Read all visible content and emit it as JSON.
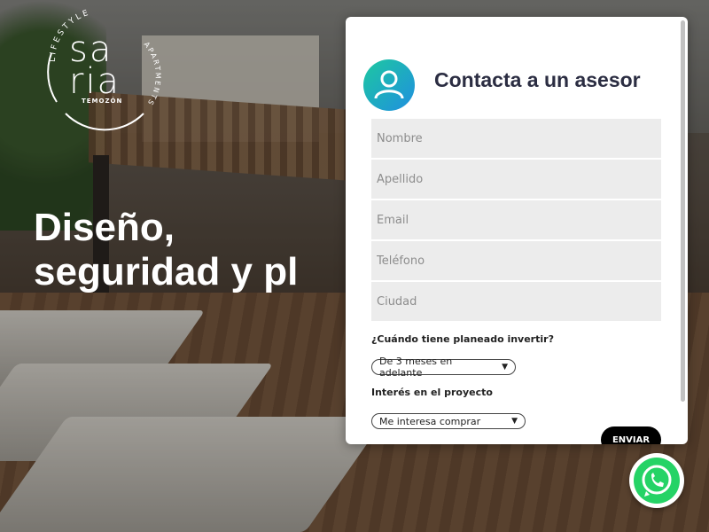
{
  "brand": {
    "name_line1": "sa",
    "name_line2": "ria",
    "tagline_top": "LIFESTYLE",
    "tagline_right": "APARTMENTS",
    "location": "TEMOZÓN"
  },
  "hero": {
    "headline_line1": "Diseño,",
    "headline_line2": "seguridad y pl"
  },
  "form": {
    "title": "Contacta a un asesor",
    "fields": {
      "first_name_placeholder": "Nombre",
      "last_name_placeholder": "Apellido",
      "email_placeholder": "Email",
      "phone_placeholder": "Teléfono",
      "city_placeholder": "Ciudad"
    },
    "invest_question": "¿Cuándo tiene planeado invertir?",
    "invest_selected": "De 3 meses en adelante",
    "interest_question": "Interés en el proyecto",
    "interest_selected": "Me interesa comprar",
    "submit_label": "ENVIAR"
  },
  "icons": {
    "avatar": "user-icon",
    "whatsapp": "whatsapp-icon",
    "select_caret": "chevron-down-icon"
  },
  "colors": {
    "accent_gradient_start": "#1ec8a0",
    "accent_gradient_end": "#1f8fe0",
    "title_color": "#2b2d42",
    "whatsapp_green": "#25d366",
    "submit_bg": "#000000"
  }
}
